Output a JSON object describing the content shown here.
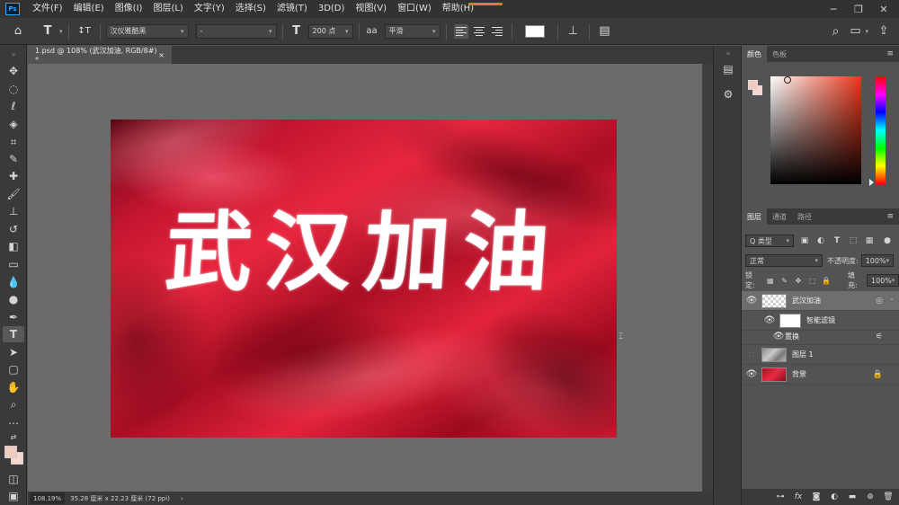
{
  "app": {
    "logo": "Ps"
  },
  "menu": [
    "文件(F)",
    "编辑(E)",
    "图像(I)",
    "图层(L)",
    "文字(Y)",
    "选择(S)",
    "滤镜(T)",
    "3D(D)",
    "视图(V)",
    "窗口(W)",
    "帮助(H)"
  ],
  "window_controls": {
    "minimize": "─",
    "restore": "❐",
    "close": "✕"
  },
  "options": {
    "home_icon": "⌂",
    "type_tool_glyph": "T",
    "orientation_glyph": "↕T",
    "font_family": "汉仪雅酷黑",
    "font_style": "-",
    "size_glyph": "T",
    "font_size": "200 点",
    "aa_glyph": "aa",
    "antialias": "平滑",
    "warp_glyph": "⊥",
    "panel_glyph": "▤",
    "search_glyph": "⌕",
    "share_glyph": "⇪"
  },
  "document": {
    "tab_title": "1.psd @ 108% (武汉加油, RGB/8#) *",
    "tab_close": "×",
    "artwork_text": "武汉加油"
  },
  "status": {
    "zoom": "108.19%",
    "doc_info": "35.28 厘米 x 22.23 厘米 (72 ppi)",
    "arrow": "›"
  },
  "color_panel": {
    "tabs": [
      "颜色",
      "色板"
    ],
    "menu": "≡"
  },
  "layers_panel": {
    "tabs": [
      "图层",
      "通道",
      "路径"
    ],
    "menu": "≡",
    "filter_kind": "Q 类型",
    "blend_mode": "正常",
    "opacity_label": "不透明度:",
    "opacity_value": "100%",
    "lock_label": "锁定:",
    "fill_label": "填充:",
    "fill_value": "100%",
    "layers": [
      {
        "name": "武汉加油",
        "visible": true
      },
      {
        "name": "智能滤镜",
        "visible": true
      },
      {
        "name": "置换",
        "visible": true
      },
      {
        "name": "图层 1",
        "visible": false
      },
      {
        "name": "背景",
        "visible": true
      }
    ]
  },
  "colors": {
    "foreground": "#f2cbc0",
    "background": "#f7d8d0",
    "accent": "#31a8ff"
  }
}
